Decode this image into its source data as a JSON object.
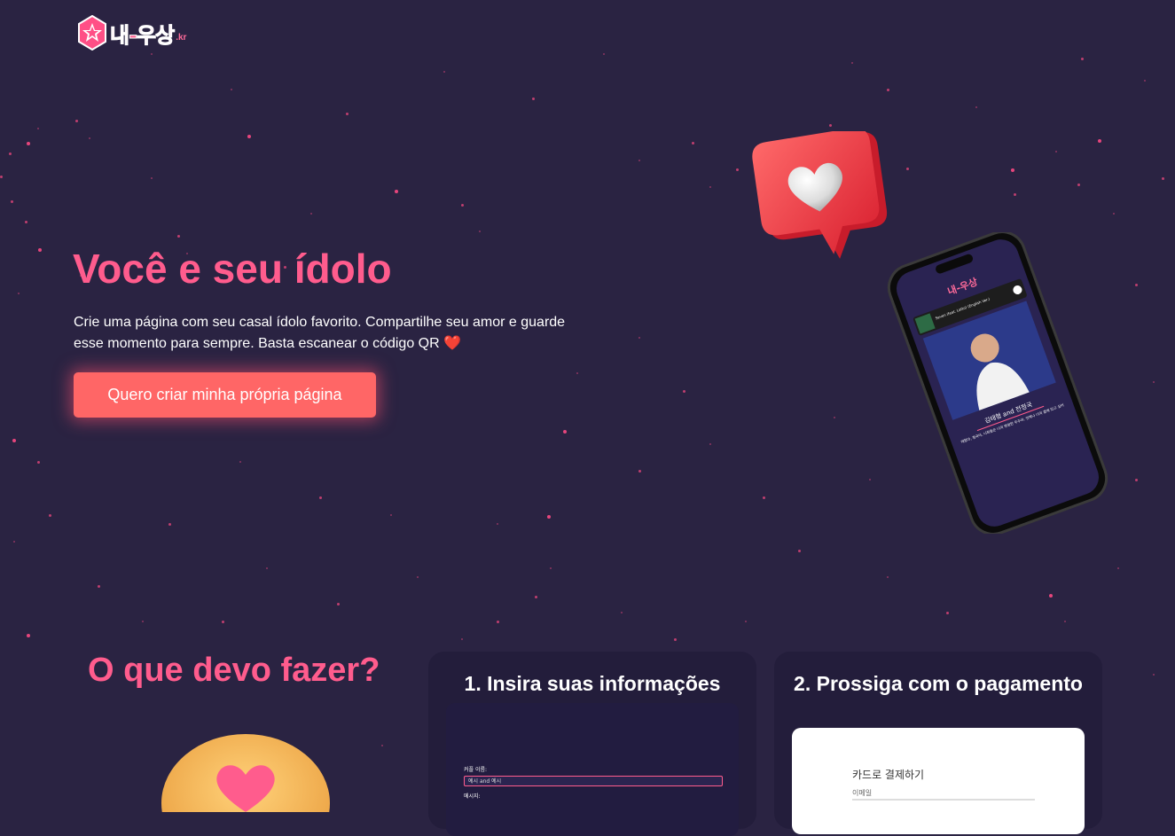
{
  "header": {
    "logo_text": "내-우상",
    "logo_suffix": ".kr"
  },
  "hero": {
    "title": "Você e seu ídolo",
    "description": "Crie uma página com seu casal ídolo favorito. Compartilhe seu amor e guarde esse momento para sempre. Basta escanear o código QR",
    "heart": "❤️",
    "cta_label": "Quero criar minha própria página"
  },
  "phone_preview": {
    "logo_text": "내-우상",
    "song_title": "Seven (feat. Latto) (English Ver.)",
    "couple_name": "김태형 and 전정국",
    "message": "태형아, 정국아, 너희들은 나의 영원한 우주야. 언제나 너의 곁에 있고 싶어"
  },
  "how": {
    "title": "O que devo fazer?"
  },
  "steps": [
    {
      "title": "1. Insira suas informações",
      "field1_label": "커플 이름:",
      "field1_value": "예시 and 예시",
      "field2_label": "메시지:"
    },
    {
      "title": "2. Prossiga com o pagamento",
      "pay_title": "카드로 결제하기",
      "pay_field_label": "이메일"
    }
  ],
  "colors": {
    "background": "#2a2342",
    "accent": "#ff5c8d",
    "button": "#ff6666",
    "card": "#231d3b",
    "star": "#f0487f"
  },
  "icons": [
    "star-logo-icon",
    "heart-bubble-icon",
    "heart-emoji-icon",
    "cookie-heart-icon",
    "phone-mockup"
  ]
}
